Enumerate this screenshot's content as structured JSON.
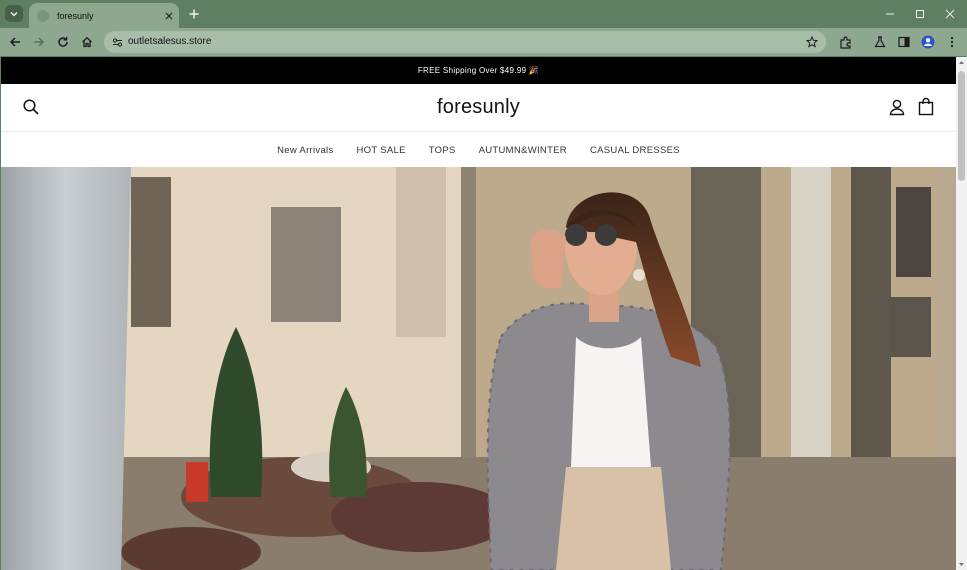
{
  "browser": {
    "tab": {
      "title": "foresunly"
    },
    "address_bar": {
      "url": "outletsalesus.store"
    }
  },
  "page": {
    "announcement": "FREE Shipping Over $49.99 🎉",
    "logo": "foresunly",
    "nav": [
      {
        "label": "New Arrivals"
      },
      {
        "label": "HOT SALE"
      },
      {
        "label": "TOPS"
      },
      {
        "label": "AUTUMN&WINTER"
      },
      {
        "label": "CASUAL DRESSES"
      }
    ]
  },
  "colors": {
    "browser_frame": "#5f7f63",
    "toolbar": "#8ea88f",
    "announcement_bg": "#000000",
    "page_bg": "#ffffff"
  },
  "icons": [
    "tab-search-icon",
    "favicon-icon",
    "close-icon",
    "plus-icon",
    "minimize-icon",
    "maximize-icon",
    "window-close-icon",
    "back-icon",
    "forward-icon",
    "reload-icon",
    "home-icon",
    "site-info-icon",
    "star-icon",
    "extensions-icon",
    "labs-icon",
    "side-panel-icon",
    "profile-icon",
    "menu-icon",
    "search-icon",
    "account-icon",
    "cart-icon"
  ]
}
